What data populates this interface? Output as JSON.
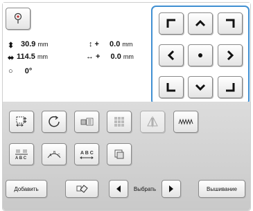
{
  "measurements": {
    "height_value": "30.9",
    "height_unit": "mm",
    "width_value": "114.5",
    "width_unit": "mm",
    "vertical_offset": "0.0",
    "horizontal_offset": "0.0",
    "offset_unit": "mm",
    "angle": "0°"
  },
  "bottom_bar": {
    "add_label": "Добавить",
    "select_label": "Выбрать",
    "embroider_label": "Вышивание"
  },
  "colors": {
    "panel_border": "#3f8fd2",
    "button_gray": "#e4e4e4",
    "background_gray": "#cfcfcf"
  },
  "icons": [
    "pin-icon",
    "arrow-up-left-icon",
    "arrow-up-icon",
    "arrow-up-right-icon",
    "arrow-left-icon",
    "center-dot-icon",
    "arrow-right-icon",
    "arrow-down-left-icon",
    "arrow-down-icon",
    "arrow-down-right-icon",
    "resize-icon",
    "rotate-icon",
    "density-icon",
    "array-icon",
    "mirror-icon",
    "border-icon",
    "text-align-icon",
    "text-arc-icon",
    "text-spacing-icon",
    "frame-icon",
    "eraser-icon",
    "arrow-left-small-icon",
    "arrow-right-small-icon"
  ]
}
